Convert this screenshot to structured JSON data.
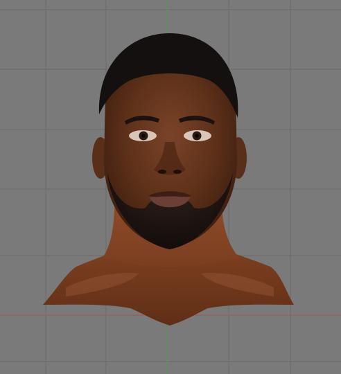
{
  "viewport": {
    "type": "3d-model-viewport",
    "background_color": "#7a7a7a",
    "grid_color": "#6a6a6a",
    "x_axis_color": "#a05050",
    "y_axis_color": "#4f9a4f",
    "subject": "head-and-neck-mesh"
  },
  "model": {
    "skin_color": "#6b3a22",
    "neck_color": "#8a4a2a",
    "hair_color": "#141010",
    "beard_color": "#1c1614"
  }
}
